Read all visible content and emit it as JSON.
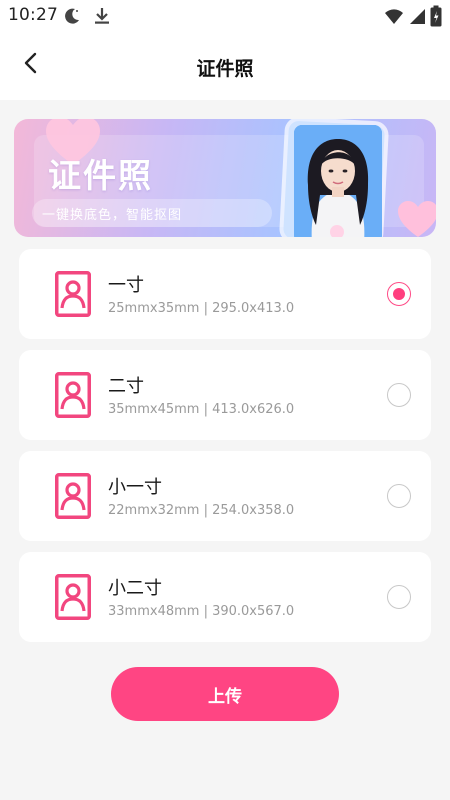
{
  "status_bar": {
    "time": "10:27",
    "icons": [
      "moon-icon",
      "download-icon",
      "wifi-icon",
      "signal-icon",
      "battery-icon"
    ]
  },
  "header": {
    "back_icon": "chevron-left-icon",
    "title": "证件照"
  },
  "banner": {
    "title": "证件照",
    "subtitle": "一键换底色，智能抠图"
  },
  "options": [
    {
      "name": "一寸",
      "spec": "25mmx35mm | 295.0x413.0",
      "selected": true
    },
    {
      "name": "二寸",
      "spec": "35mmx45mm | 413.0x626.0",
      "selected": false
    },
    {
      "name": "小一寸",
      "spec": "22mmx32mm | 254.0x358.0",
      "selected": false
    },
    {
      "name": "小二寸",
      "spec": "33mmx48mm | 390.0x567.0",
      "selected": false
    }
  ],
  "upload_label": "上传",
  "colors": {
    "accent": "#ff4583",
    "radio_selected": "#ff3f7f",
    "background": "#f5f5f5",
    "card": "#ffffff",
    "spec_text": "#9a9a9a"
  }
}
